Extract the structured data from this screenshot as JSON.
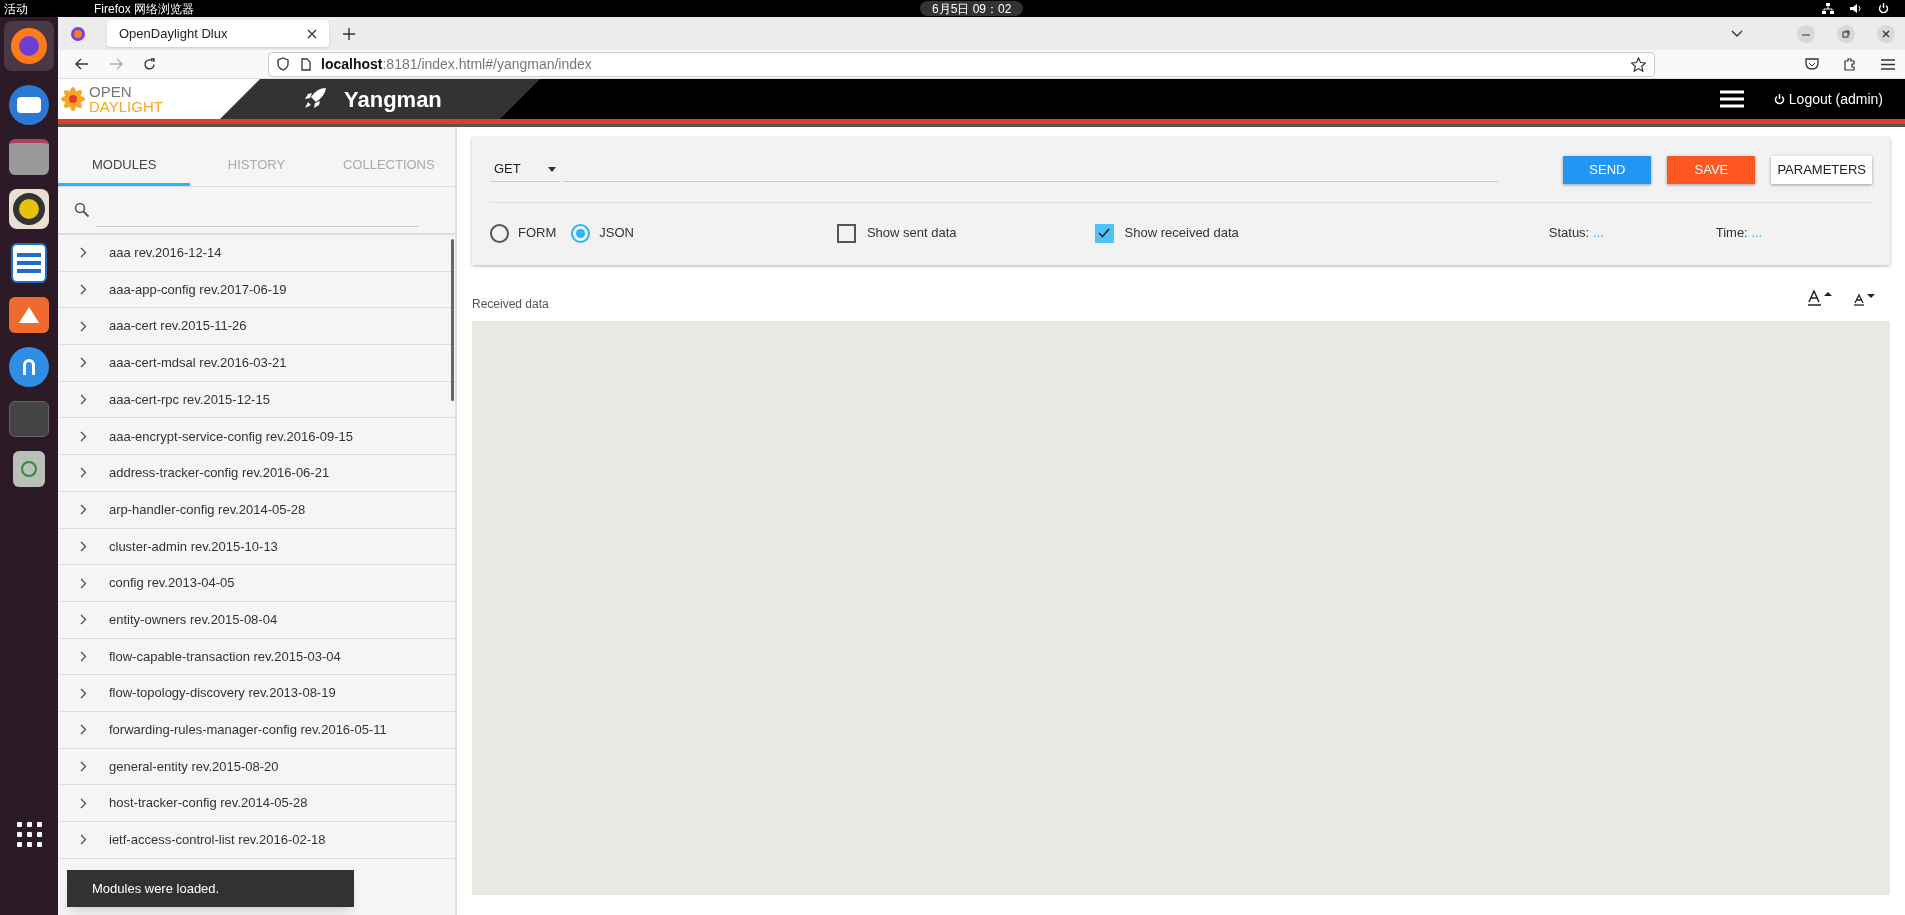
{
  "system_bar": {
    "activities": "活动",
    "app_name": "Firefox 网络浏览器",
    "clock": "6月5日  09：02"
  },
  "browser": {
    "tab_title": "OpenDaylight Dlux",
    "url_host": "localhost",
    "url_rest": ":8181/index.html#/yangman/index"
  },
  "app_header": {
    "logo_top": "OPEN",
    "logo_bottom": "DAYLIGHT",
    "title": "Yangman",
    "logout": "Logout (admin)"
  },
  "sidebar": {
    "tabs": [
      {
        "label": "MODULES",
        "selected": true
      },
      {
        "label": "HISTORY",
        "selected": false
      },
      {
        "label": "COLLECTIONS",
        "selected": false
      }
    ],
    "modules": [
      "aaa rev.2016-12-14",
      "aaa-app-config rev.2017-06-19",
      "aaa-cert rev.2015-11-26",
      "aaa-cert-mdsal rev.2016-03-21",
      "aaa-cert-rpc rev.2015-12-15",
      "aaa-encrypt-service-config rev.2016-09-15",
      "address-tracker-config rev.2016-06-21",
      "arp-handler-config rev.2014-05-28",
      "cluster-admin rev.2015-10-13",
      "config rev.2013-04-05",
      "entity-owners rev.2015-08-04",
      "flow-capable-transaction rev.2015-03-04",
      "flow-topology-discovery rev.2013-08-19",
      "forwarding-rules-manager-config rev.2016-05-11",
      "general-entity rev.2015-08-20",
      "host-tracker-config rev.2014-05-28",
      "ietf-access-control-list rev.2016-02-18"
    ]
  },
  "request": {
    "method": "GET",
    "buttons": [
      {
        "label": "SEND",
        "kind": "primary"
      },
      {
        "label": "SAVE",
        "kind": "warning"
      },
      {
        "label": "PARAMETERS",
        "kind": "plain"
      }
    ],
    "formats": [
      {
        "label": "FORM",
        "selected": false
      },
      {
        "label": "JSON",
        "selected": true
      }
    ],
    "checkboxes": [
      {
        "label": "Show sent data",
        "checked": false
      },
      {
        "label": "Show received data",
        "checked": true
      }
    ],
    "status_label": "Status:",
    "status_value": "...",
    "time_label": "Time:",
    "time_value": "..."
  },
  "received": {
    "label": "Received data"
  },
  "toast": "Modules were loaded."
}
